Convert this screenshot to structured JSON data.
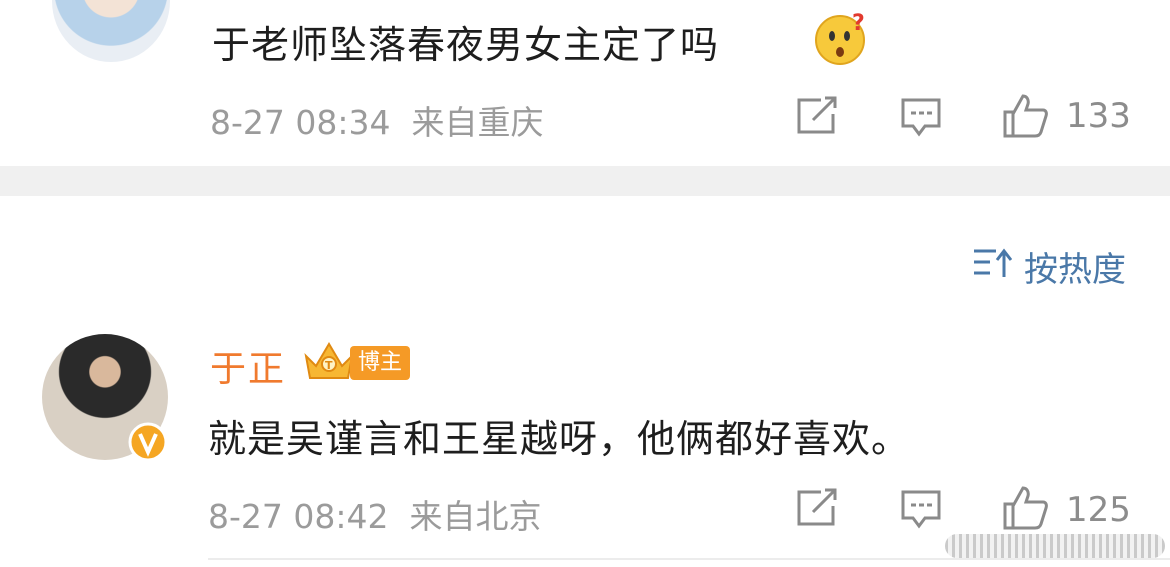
{
  "comments": [
    {
      "text": "于老师坠落春夜男女主定了吗",
      "emoji": "surprised-face-emoji",
      "time": "8-27 08:34",
      "location": "来自重庆",
      "likes": "133"
    },
    {
      "username": "于正",
      "badge_label": "博主",
      "text": "就是吴谨言和王星越呀，他俩都好喜欢。",
      "time": "8-27 08:42",
      "location": "来自北京",
      "likes": "125"
    }
  ],
  "sort": {
    "label": "按热度"
  },
  "colors": {
    "accent": "#f07a2e",
    "sort_blue": "#4a78a8",
    "badge": "#f59a26",
    "meta_gray": "#9b9b9b"
  }
}
